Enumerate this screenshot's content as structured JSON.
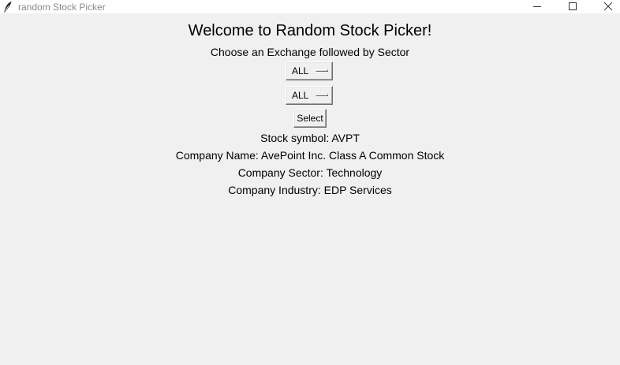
{
  "window": {
    "title": "random Stock Picker"
  },
  "main": {
    "heading": "Welcome to Random Stock Picker!",
    "subheading": "Choose an Exchange followed by Sector",
    "exchange_select": {
      "value": "ALL"
    },
    "sector_select": {
      "value": "ALL"
    },
    "select_button_label": "Select",
    "stock_symbol": "Stock symbol: AVPT",
    "company_name": "Company Name: AvePoint Inc. Class A Common Stock",
    "company_sector": "Company Sector: Technology",
    "company_industry": "Company Industry: EDP Services"
  },
  "icons": {
    "app": "feather-icon",
    "minimize": "minimize-icon",
    "maximize": "maximize-icon",
    "close": "close-icon"
  },
  "colors": {
    "background": "#f0f0f0",
    "titlebar": "#ffffff",
    "title_text": "#8a8a8a"
  }
}
